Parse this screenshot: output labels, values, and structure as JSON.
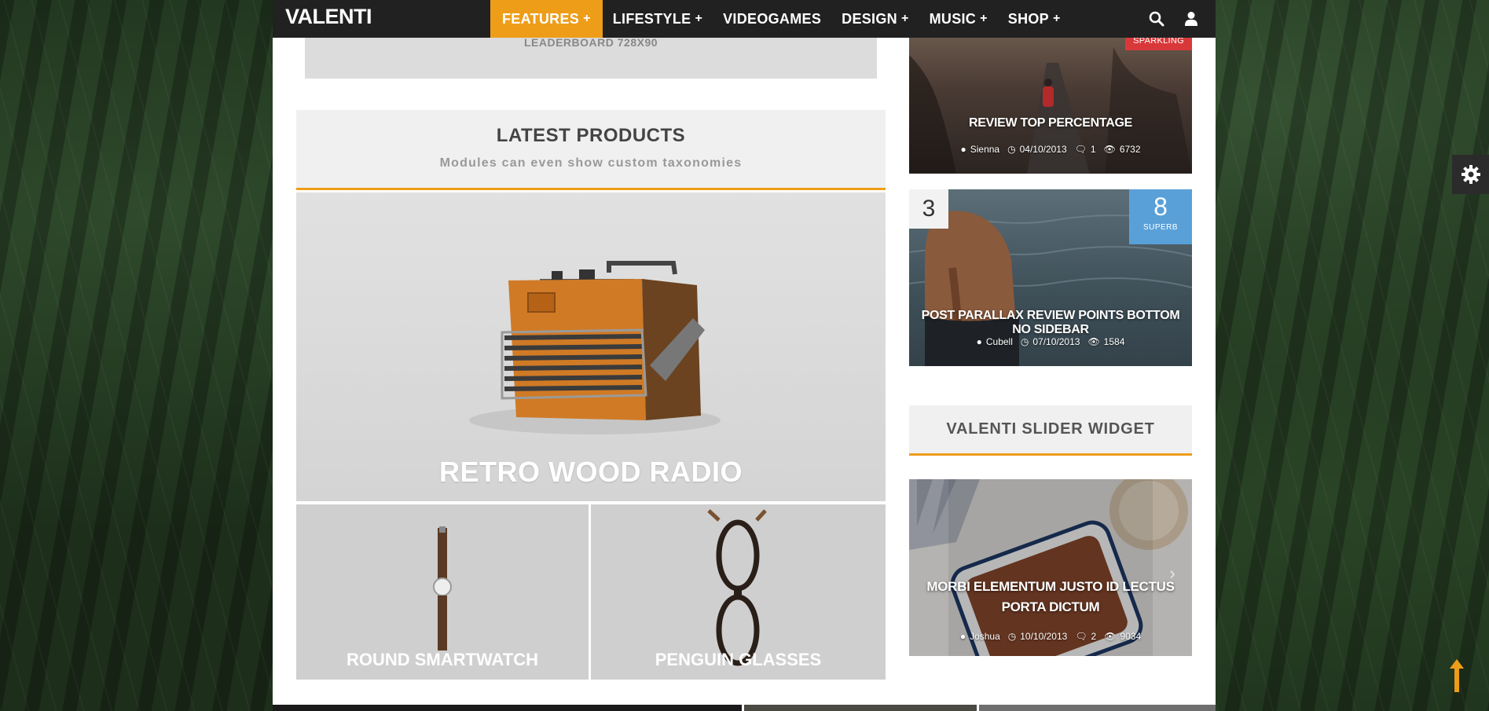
{
  "nav": {
    "logo": "VALENTI",
    "menu": [
      {
        "label": "FEATURES",
        "plus": "+"
      },
      {
        "label": "LIFESTYLE",
        "plus": "+"
      },
      {
        "label": "VIDEOGAMES",
        "plus": ""
      },
      {
        "label": "DESIGN",
        "plus": "+"
      },
      {
        "label": "MUSIC",
        "plus": "+"
      },
      {
        "label": "SHOP",
        "plus": "+"
      }
    ],
    "icons": [
      "search-icon",
      "user-icon"
    ],
    "accent": "#ee9d19"
  },
  "leaderboard": {
    "text": "LEADERBOARD 728X90"
  },
  "latest_products": {
    "title": "LATEST PRODUCTS",
    "subtitle": "Modules can even show custom taxonomies",
    "main": {
      "title": "RETRO WOOD RADIO"
    },
    "items": [
      {
        "title": "ROUND SMARTWATCH"
      },
      {
        "title": "PENGUIN GLASSES"
      }
    ]
  },
  "sidebar_cards": [
    {
      "badge": "SPARKLING",
      "title": "REVIEW TOP PERCENTAGE",
      "author": "Sienna",
      "date": "04/10/2013",
      "comments": "1",
      "views": "6732"
    },
    {
      "number": "3",
      "score": "8",
      "score_label": "SUPERB",
      "title": "POST PARALLAX REVIEW POINTS BOTTOM NO SIDEBAR",
      "author": "Cubell",
      "date": "07/10/2013",
      "views": "1584"
    }
  ],
  "slider_widget": {
    "title": "VALENTI SLIDER WIDGET",
    "slide": {
      "title": "MORBI ELEMENTUM JUSTO ID LECTUS PORTA DICTUM",
      "author": "Joshua",
      "date": "10/10/2013",
      "comments": "2",
      "views": "9034"
    }
  },
  "colors": {
    "accent": "#ee9d19",
    "badge_red": "#d9383a",
    "score_blue": "#5aa0d8",
    "nav_bg": "#212121"
  }
}
